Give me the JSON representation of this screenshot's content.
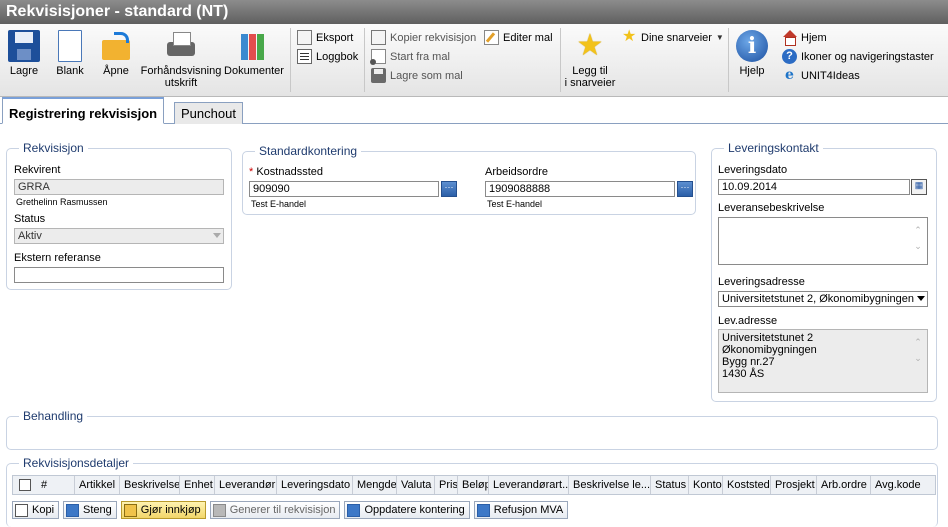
{
  "window": {
    "title": "Rekvisisjoner - standard (NT)"
  },
  "toolbar": {
    "save": "Lagre",
    "blank": "Blank",
    "open": "Åpne",
    "print_preview_line1": "Forhåndsvisning",
    "print_preview_line2": "utskrift",
    "documents": "Dokumenter",
    "export": "Eksport",
    "log": "Loggbok",
    "copy_requisition": "Kopier rekvisisjon",
    "start_from_template": "Start fra mal",
    "save_as_template": "Lagre som mal",
    "edit_template": "Editer mal",
    "add_shortcut_line1": "Legg til",
    "add_shortcut_line2": "i snarveier",
    "my_shortcuts": "Dine snarveier",
    "help": "Hjelp",
    "home": "Hjem",
    "icons_navigation": "Ikoner og navigeringstaster",
    "unit4ideas": "UNIT4Ideas"
  },
  "tabs": [
    {
      "label": "Registrering rekvisisjon",
      "active": true
    },
    {
      "label": "Punchout",
      "active": false
    }
  ],
  "requisition": {
    "legend": "Rekvisisjon",
    "requester_label": "Rekvirent",
    "requester_value": "GRRA",
    "requester_name": "Grethelinn Rasmussen",
    "status_label": "Status",
    "status_value": "Aktiv",
    "external_ref_label": "Ekstern referanse",
    "external_ref_value": ""
  },
  "standard_posting": {
    "legend": "Standardkontering",
    "required_marker": "*",
    "cost_center_label": "Kostnadssted",
    "cost_center_value": "909090",
    "cost_center_desc": "Test E-handel",
    "work_order_label": "Arbeidsordre",
    "work_order_value": "1909088888",
    "work_order_desc": "Test E-handel"
  },
  "delivery_contact": {
    "legend": "Leveringskontakt",
    "delivery_date_label": "Leveringsdato",
    "delivery_date_value": "10.09.2014",
    "delivery_desc_label": "Leveransebeskrivelse",
    "delivery_desc_value": "",
    "delivery_address_label": "Leveringsadresse",
    "delivery_address_value": "Universitetstunet 2, Økonomibygningen",
    "lev_address_label": "Lev.adresse",
    "lev_address_lines": [
      "Universitetstunet 2",
      "Økonomibygningen",
      "Bygg nr.27",
      "1430 ÅS"
    ]
  },
  "processing": {
    "legend": "Behandling"
  },
  "details": {
    "legend": "Rekvisisjonsdetaljer",
    "columns": [
      "#",
      "Artikkel",
      "Beskrivelse",
      "Enhet",
      "Leverandør",
      "Leveringsdato",
      "Mengde",
      "Valuta",
      "Pris",
      "Beløp",
      "Leverandørart...",
      "Beskrivelse le...",
      "Status",
      "Konto",
      "Koststed",
      "Prosjekt",
      "Arb.ordre",
      "Avg.kode"
    ],
    "buttons": [
      "Kopi",
      "Steng",
      "Gjør innkjøp",
      "Generer til rekvisisjon",
      "Oppdatere kontering",
      "Refusjon MVA"
    ]
  },
  "colors": {
    "title_bar": "#707070",
    "legend_text": "#1f3b6e",
    "accent": "#2b5fa8"
  }
}
